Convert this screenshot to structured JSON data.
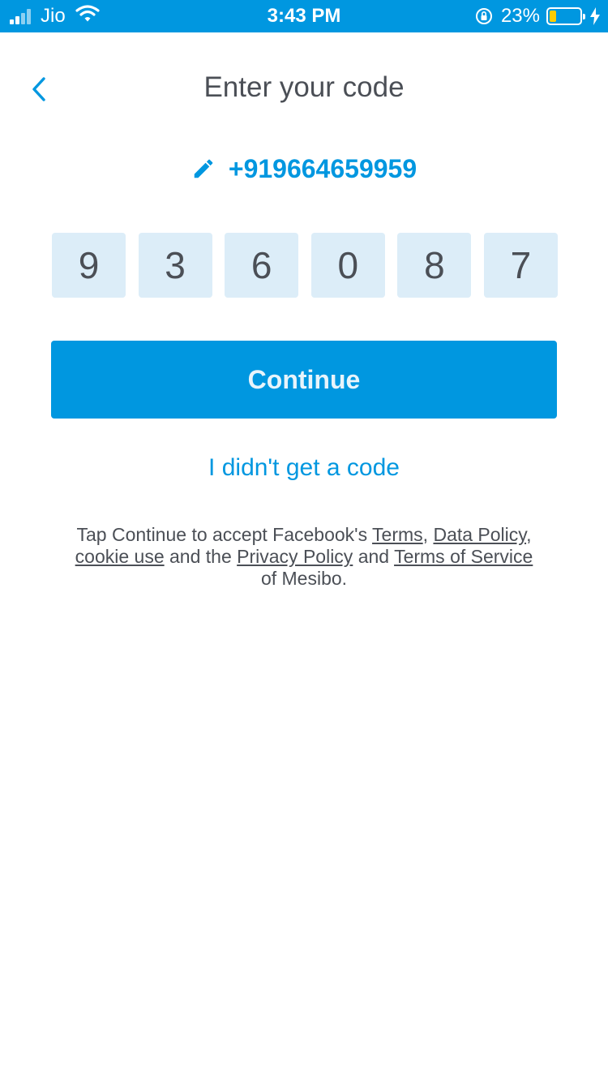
{
  "status_bar": {
    "carrier": "Jio",
    "time": "3:43 PM",
    "battery_percent": "23%",
    "battery_level": 0.23,
    "icons": [
      "signal-icon",
      "wifi-icon",
      "rotation-lock-icon",
      "battery-icon",
      "charging-icon"
    ]
  },
  "header": {
    "title": "Enter your code",
    "back_icon": "chevron-left-icon"
  },
  "phone": {
    "number": "+919664659959",
    "edit_icon": "pencil-icon"
  },
  "code": {
    "digits": [
      "9",
      "3",
      "6",
      "0",
      "8",
      "7"
    ]
  },
  "actions": {
    "continue_label": "Continue",
    "resend_label": "I didn't get a code"
  },
  "terms": {
    "part1": "Tap Continue to accept Facebook's ",
    "terms_link": "Terms",
    "sep1": ", ",
    "data_policy_link": "Data Policy",
    "sep2": ",",
    "cookie_link": "cookie use",
    "part2": " and the ",
    "privacy_link": "Privacy Policy",
    "part3": " and ",
    "tos_link": "Terms of Service",
    "part4": "of Mesibo."
  },
  "colors": {
    "accent": "#0097e0",
    "code_box_bg": "#dcedf8",
    "text": "#4b4f56",
    "battery_fill": "#ffcc00"
  }
}
